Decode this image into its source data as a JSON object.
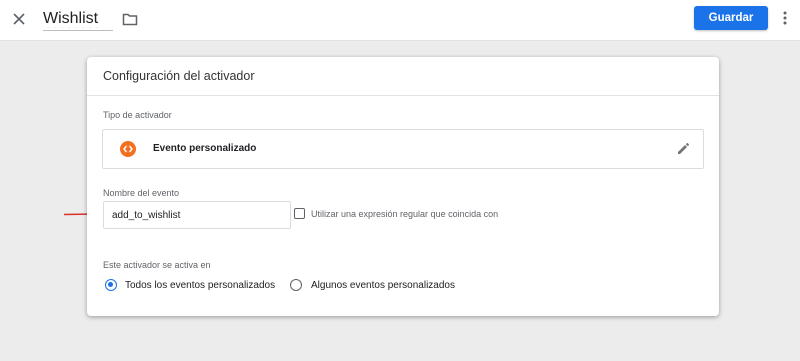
{
  "topbar": {
    "title": "Wishlist",
    "save_label": "Guardar",
    "icons": {
      "close": "close-icon",
      "folder": "folder-icon",
      "more": "more-vert-icon"
    }
  },
  "card": {
    "title": "Configuración del activador",
    "trigger_type": {
      "label": "Tipo de activador",
      "name": "Evento personalizado",
      "icon": "code-brackets-icon",
      "icon_color": "#f37021"
    },
    "event": {
      "label": "Nombre del evento",
      "value": "add_to_wishlist",
      "regex_checked": false,
      "regex_label": "Utilizar una expresión regular que coincida con"
    },
    "fires_on": {
      "label": "Este activador se activa en",
      "options": [
        {
          "label": "Todos los eventos personalizados",
          "selected": true
        },
        {
          "label": "Algunos eventos personalizados",
          "selected": false
        }
      ]
    }
  },
  "colors": {
    "accent": "#1a73e8",
    "arrow": "#d93025"
  }
}
